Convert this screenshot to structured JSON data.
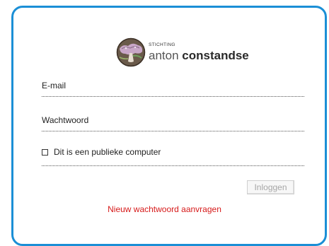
{
  "logo": {
    "small_text": "STICHTING",
    "name_light": "anton",
    "name_bold": "constandse"
  },
  "form": {
    "email_label": "E-mail",
    "email_value": "",
    "password_label": "Wachtwoord",
    "password_value": "",
    "public_computer_label": "Dit is een publieke computer",
    "public_computer_checked": false,
    "login_button_label": "Inloggen",
    "reset_link_label": "Nieuw wachtwoord aanvragen"
  },
  "colors": {
    "frame_border": "#1b8fd6",
    "link": "#d61a1a",
    "button_text_disabled": "#a6a6a6"
  }
}
